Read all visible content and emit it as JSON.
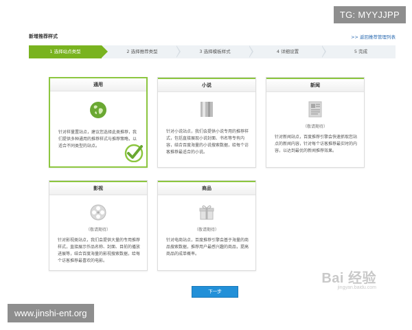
{
  "watermarks": {
    "top": "TG: MYYJJPP",
    "bottom": "www.jinshi-ent.org",
    "baidu_logo": "Bai 经验",
    "baidu_url": "jingyan.baidu.com"
  },
  "header": {
    "title": "新增推荐样式",
    "back_link": "返回推荐管理列表",
    "back_arrow": ">>"
  },
  "steps": [
    {
      "label": "1 选择站点类型",
      "active": true
    },
    {
      "label": "2 选择推荐类型",
      "active": false
    },
    {
      "label": "3 选择模板样式",
      "active": false
    },
    {
      "label": "4 详细设置",
      "active": false
    },
    {
      "label": "5 完成",
      "active": false
    }
  ],
  "cards": [
    {
      "title": "通用",
      "desc": "针对样量置站点，建议您选择此类推荐，我们提供多种通用的推荐样式与推荐策略，以适合不同类型的站点。",
      "soon": "",
      "selected": true,
      "icon": "globe-icon"
    },
    {
      "title": "小说",
      "desc": "针对小说站点，我们会提供小说专用的推荐样式，包括直接展现小说封面、书名等专有内容，结合百度海量的小说搜索数据，给每个访客推荐最适合的小说。",
      "soon": "",
      "selected": false,
      "icon": "book-icon"
    },
    {
      "title": "新闻",
      "desc": "针对新闻站点，百度推荐引擎会快速抓取您站点的新闻内容，针对每个访客推荐最实时的内容，以达到最优的新闻推荐效果。",
      "soon": "（敬请期待）",
      "selected": false,
      "icon": "newspaper-icon"
    },
    {
      "title": "影视",
      "desc": "针对影视类站点，我们会提供大量的专用推荐样式，直接展示作品名称、封面、目前的播放进展等，结合百度海量的影视搜索数据，给每个访客推荐最喜欢的电影。",
      "soon": "（敬请期待）",
      "selected": false,
      "icon": "film-reel-icon"
    },
    {
      "title": "商品",
      "desc": "针对电商站点，百度推荐引擎会基于海量的商品搜索数据，推荐用户最感兴趣的商品，提高商品的成单概率。",
      "soon": "（敬请期待）",
      "selected": false,
      "icon": "gift-icon"
    }
  ],
  "next_button": "下一步",
  "colors": {
    "accent_green": "#79b31f",
    "button_blue": "#2290d8",
    "link_blue": "#2a6ab1"
  }
}
